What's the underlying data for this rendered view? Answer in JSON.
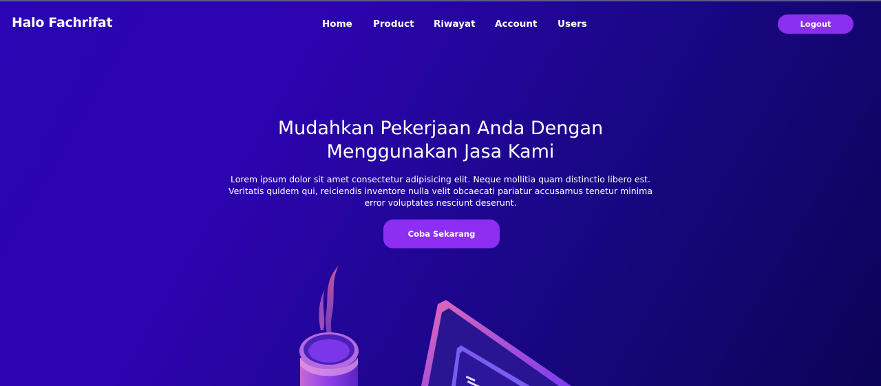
{
  "nav": {
    "brand": "Halo Fachrifat",
    "links": [
      "Home",
      "Product",
      "Riwayat",
      "Account",
      "Users"
    ],
    "logout": "Logout"
  },
  "hero": {
    "title": "Mudahkan Pekerjaan Anda Dengan Menggunakan Jasa Kami",
    "text": "Lorem ipsum dolor sit amet consectetur adipisicing elit. Neque mollitia quam distinctio libero est. Veritatis quidem qui, reiciendis inventore nulla velit obcaecati pariatur accusamus tenetur minima error voluptates nesciunt deserunt.",
    "cta": "Coba Sekarang"
  },
  "colors": {
    "accent": "#8a2ef0",
    "bg_start": "#2a05b3",
    "bg_end": "#0c0457"
  }
}
